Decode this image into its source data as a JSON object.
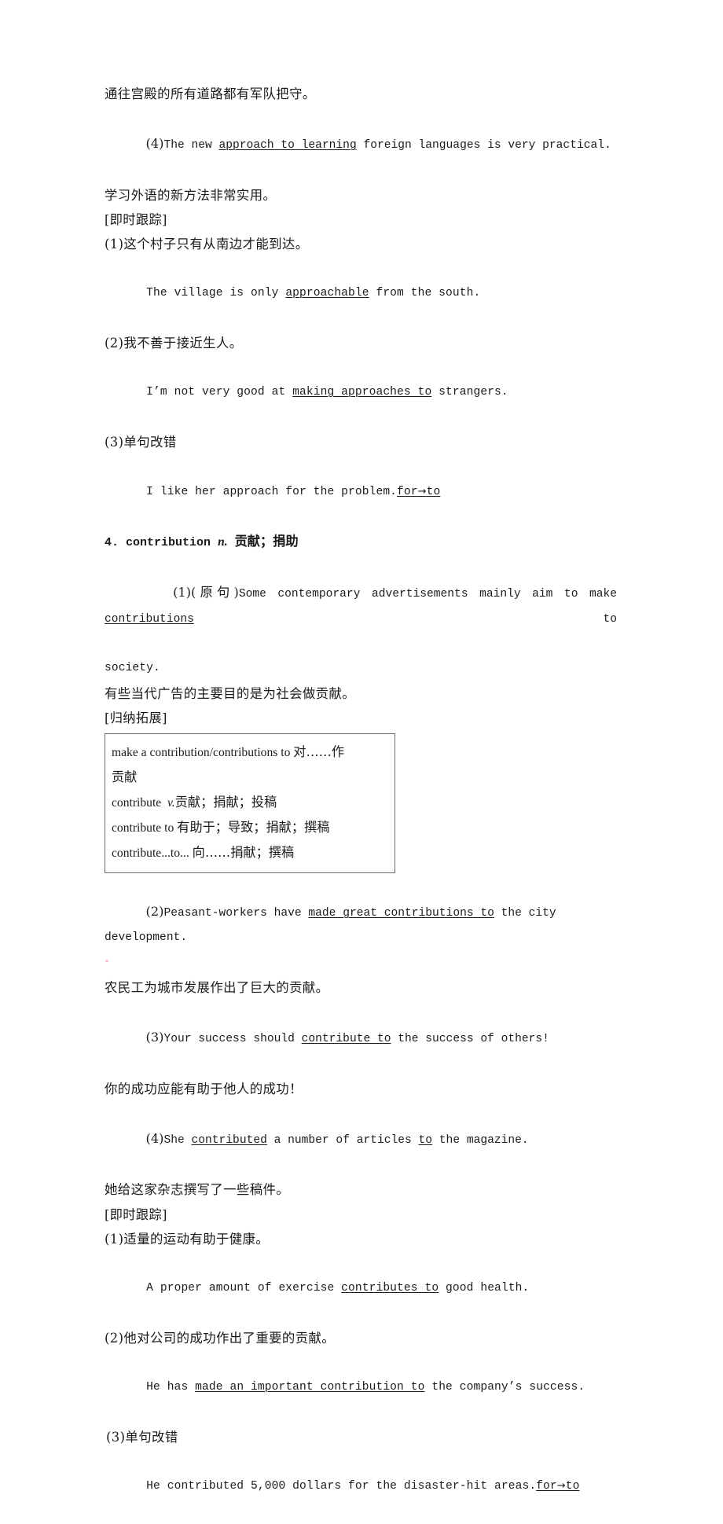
{
  "page": {
    "language_note": "Chinese-English vocabulary study page",
    "lines": [
      {
        "id": "l1",
        "kind": "cn",
        "text": "通往宫殿的所有道路都有军队把守。"
      },
      {
        "id": "l2",
        "kind": "mix",
        "marker": "(4)",
        "pre": "The new ",
        "underline": "approach to learning",
        "post": " foreign languages is very practical."
      },
      {
        "id": "l3",
        "kind": "cn",
        "text": "学习外语的新方法非常实用。"
      },
      {
        "id": "l4",
        "kind": "tag",
        "text": "[即时跟踪]"
      },
      {
        "id": "l5",
        "kind": "cn",
        "text": "(1)这个村子只有从南边才能到达。"
      },
      {
        "id": "l6",
        "kind": "en",
        "pre": "The village is only ",
        "underline": "approachable",
        "post": " from the south."
      },
      {
        "id": "l7",
        "kind": "cn",
        "text": "(2)我不善于接近生人。"
      },
      {
        "id": "l8",
        "kind": "en",
        "pre": "I’m not very good at ",
        "underline": "making approaches to",
        "post": " strangers."
      },
      {
        "id": "l9",
        "kind": "cn",
        "text": "(3)单句改错"
      },
      {
        "id": "l10",
        "kind": "en-correction",
        "pre": "I like her approach for the problem.",
        "wrong": "for",
        "arrow": "→",
        "right": "to"
      }
    ],
    "entry": {
      "number": "4.",
      "word": "contribution",
      "pos": "n.",
      "gloss": "贡献；捐助"
    },
    "entry_examples": [
      {
        "id": "e1",
        "kind": "mix-justify",
        "marker": "(1)(原句)",
        "pre": "Some contemporary advertisements mainly aim to make ",
        "underline": "contributions",
        "post": " to"
      },
      {
        "id": "e1b",
        "kind": "en",
        "pre": "society.",
        "underline": "",
        "post": ""
      },
      {
        "id": "e2",
        "kind": "cn",
        "text": "有些当代广告的主要目的是为社会做贡献。"
      }
    ],
    "expansion_tag": "[归纳拓展]",
    "expansion_box": [
      {
        "id": "b1",
        "latin": "make a contribution/contributions to ",
        "cjk": "对……作"
      },
      {
        "id": "b2",
        "latin": "",
        "cjk": "贡献"
      },
      {
        "id": "b3",
        "latin": "contribute  ",
        "italic": "v.",
        "cjk": "贡献；捐献；投稿"
      },
      {
        "id": "b4",
        "latin": "contribute to ",
        "cjk": "有助于；导致；捐献；撰稿"
      },
      {
        "id": "b5",
        "latin": "contribute...to... ",
        "cjk": "向……捐献；撰稿"
      }
    ],
    "after_box": [
      {
        "id": "a1",
        "kind": "mix",
        "marker": "(2)",
        "pre": "Peasant-workers have ",
        "underline": "made great contributions to",
        "post": " the city development."
      },
      {
        "id": "a2",
        "kind": "cn",
        "text": "农民工为城市发展作出了巨大的贡献。"
      },
      {
        "id": "a3",
        "kind": "mix",
        "marker": "(3)",
        "pre": "Your success should ",
        "underline": "contribute to",
        "post": " the success of others!"
      },
      {
        "id": "a4",
        "kind": "cn",
        "text": "你的成功应能有助于他人的成功！"
      },
      {
        "id": "a5",
        "kind": "mix",
        "marker": "(4)",
        "pre": "She ",
        "underline": "contributed",
        "mid": " a number of articles ",
        "underline2": "to",
        "post": " the magazine."
      },
      {
        "id": "a6",
        "kind": "cn",
        "text": "她给这家杂志撰写了一些稿件。"
      }
    ],
    "practice_tag": "[即时跟踪]",
    "practice": [
      {
        "id": "p1",
        "kind": "cn",
        "text": "(1)适量的运动有助于健康。"
      },
      {
        "id": "p2",
        "kind": "en",
        "pre": "A proper amount of exercise ",
        "underline": "contributes to",
        "post": " good health."
      },
      {
        "id": "p3",
        "kind": "cn",
        "text": "(2)他对公司的成功作出了重要的贡献。"
      },
      {
        "id": "p4",
        "kind": "en",
        "pre": "He has ",
        "underline": "made an important contribution to",
        "post": " the company’s success."
      },
      {
        "id": "p5",
        "kind": "cn",
        "text": "(3)单句改错"
      },
      {
        "id": "p6",
        "kind": "en-correction",
        "pre": "He contributed 5,000 dollars for the disaster-hit areas.",
        "wrong": "for",
        "arrow": "→",
        "right": "to"
      }
    ]
  }
}
